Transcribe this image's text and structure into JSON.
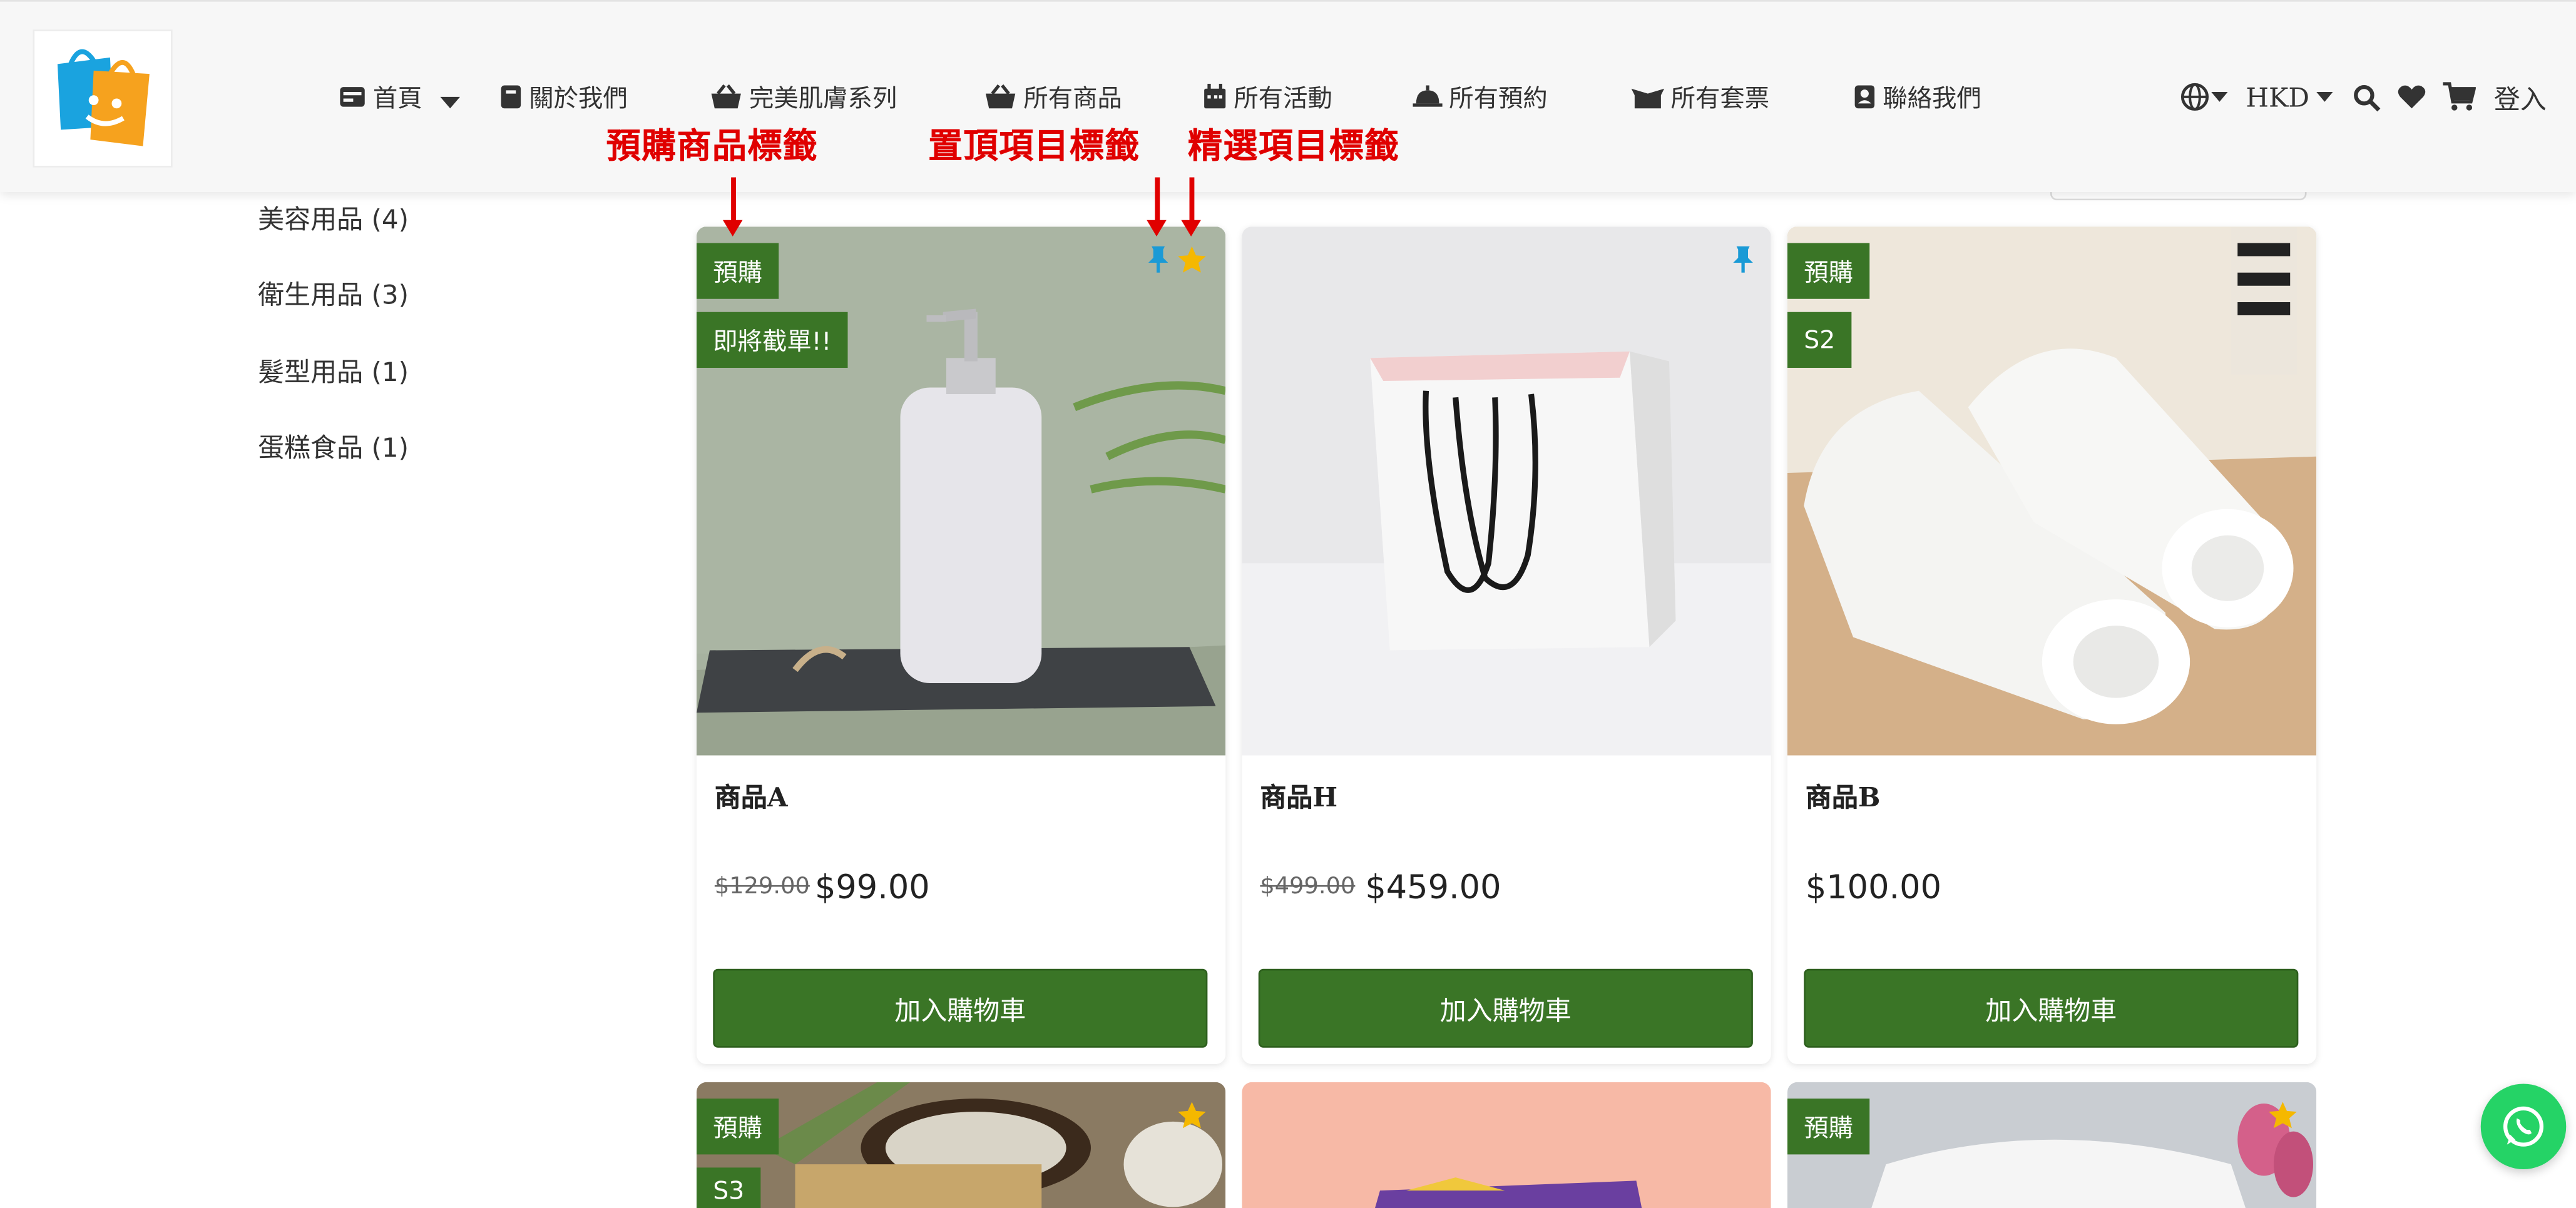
{
  "nav": {
    "items": [
      {
        "label": "首頁",
        "icon": "id-card-icon"
      },
      {
        "label": "關於我們",
        "icon": "book-icon"
      },
      {
        "label": "完美肌膚系列",
        "icon": "basket-icon"
      },
      {
        "label": "所有商品",
        "icon": "basket-icon"
      },
      {
        "label": "所有活動",
        "icon": "calendar-icon"
      },
      {
        "label": "所有預約",
        "icon": "bell-icon"
      },
      {
        "label": "所有套票",
        "icon": "ticket-box-icon"
      },
      {
        "label": "聯絡我們",
        "icon": "contact-card-icon"
      }
    ],
    "currency": "HKD",
    "login": "登入"
  },
  "annotations": {
    "preorder": "預購商品標籤",
    "pinned": "置頂項目標籤",
    "featured": "精選項目標籤"
  },
  "sidebar": {
    "categories": [
      "美容用品 (4)",
      "衛生用品 (3)",
      "髮型用品 (1)",
      "蛋糕食品 (1)"
    ]
  },
  "products": [
    {
      "name": "商品A",
      "old_price": "$129.00",
      "price": "$99.00",
      "button": "加入購物車",
      "tags": [
        "預購",
        "即將截單!!"
      ]
    },
    {
      "name": "商品H",
      "old_price": "$499.00",
      "price": "$459.00",
      "button": "加入購物車",
      "tags": []
    },
    {
      "name": "商品B",
      "old_price": "",
      "price": "$100.00",
      "button": "加入購物車",
      "tags": [
        "預購",
        "S2"
      ]
    }
  ],
  "next_row_tags": {
    "card1": [
      "預購",
      "S3"
    ],
    "card3": [
      "預購"
    ]
  },
  "colors": {
    "tag_green": "#3a7526",
    "annotation_red": "#e00000",
    "pin_blue": "#1a9ad6",
    "star_yellow": "#f5b800",
    "whatsapp_green": "#25d366"
  }
}
